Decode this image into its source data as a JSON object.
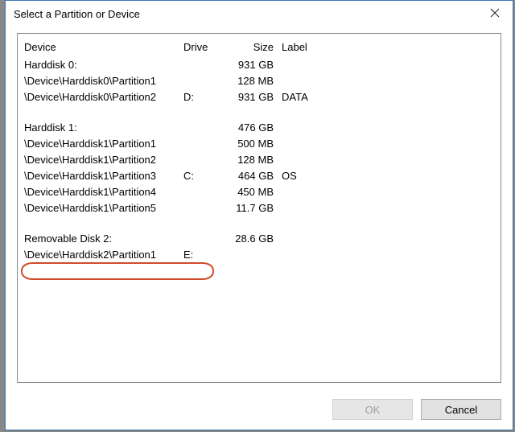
{
  "window": {
    "title": "Select a Partition or Device"
  },
  "columns": {
    "device": "Device",
    "drive": "Drive",
    "size": "Size",
    "label": "Label"
  },
  "rows": [
    {
      "device": "Harddisk 0:",
      "drive": "",
      "size": "931 GB",
      "label": ""
    },
    {
      "device": "\\Device\\Harddisk0\\Partition1",
      "drive": "",
      "size": "128 MB",
      "label": ""
    },
    {
      "device": "\\Device\\Harddisk0\\Partition2",
      "drive": "D:",
      "size": "931 GB",
      "label": "DATA"
    },
    {
      "blank": true
    },
    {
      "device": "Harddisk 1:",
      "drive": "",
      "size": "476 GB",
      "label": ""
    },
    {
      "device": "\\Device\\Harddisk1\\Partition1",
      "drive": "",
      "size": "500 MB",
      "label": ""
    },
    {
      "device": "\\Device\\Harddisk1\\Partition2",
      "drive": "",
      "size": "128 MB",
      "label": ""
    },
    {
      "device": "\\Device\\Harddisk1\\Partition3",
      "drive": "C:",
      "size": "464 GB",
      "label": "OS"
    },
    {
      "device": "\\Device\\Harddisk1\\Partition4",
      "drive": "",
      "size": "450 MB",
      "label": ""
    },
    {
      "device": "\\Device\\Harddisk1\\Partition5",
      "drive": "",
      "size": "11.7 GB",
      "label": ""
    },
    {
      "blank": true
    },
    {
      "device": "Removable Disk 2:",
      "drive": "",
      "size": "28.6 GB",
      "label": ""
    },
    {
      "device": "\\Device\\Harddisk2\\Partition1",
      "drive": "E:",
      "size": "",
      "label": ""
    }
  ],
  "buttons": {
    "ok": "OK",
    "cancel": "Cancel"
  }
}
